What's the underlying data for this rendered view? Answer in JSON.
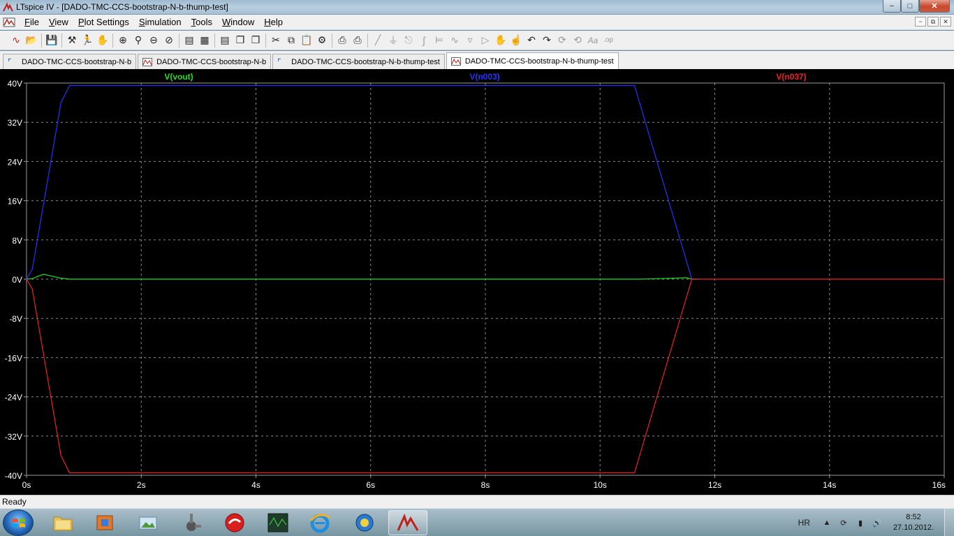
{
  "window": {
    "title": "LTspice IV - [DADO-TMC-CCS-bootstrap-N-b-thump-test]",
    "minimize": "−",
    "maximize": "□",
    "close": "✕"
  },
  "menu": {
    "items": [
      {
        "key": "F",
        "rest": "ile"
      },
      {
        "key": "V",
        "rest": "iew"
      },
      {
        "key": "P",
        "rest": "lot Settings"
      },
      {
        "key": "S",
        "rest": "imulation"
      },
      {
        "key": "T",
        "rest": "ools"
      },
      {
        "key": "W",
        "rest": "indow"
      },
      {
        "key": "H",
        "rest": "elp"
      }
    ],
    "mdi_minimize": "−",
    "mdi_restore": "⧉",
    "mdi_close": "✕"
  },
  "tabs": [
    {
      "label": "DADO-TMC-CCS-bootstrap-N-b",
      "kind": "schematic"
    },
    {
      "label": "DADO-TMC-CCS-bootstrap-N-b",
      "kind": "waveform"
    },
    {
      "label": "DADO-TMC-CCS-bootstrap-N-b-thump-test",
      "kind": "schematic"
    },
    {
      "label": "DADO-TMC-CCS-bootstrap-N-b-thump-test",
      "kind": "waveform",
      "active": true
    }
  ],
  "status": "Ready",
  "taskbar": {
    "language": "HR",
    "time": "8:52",
    "date": "27.10.2012."
  },
  "chart_data": {
    "type": "line",
    "title": "",
    "xlabel": "",
    "ylabel": "",
    "xlim": [
      0,
      16
    ],
    "ylim": [
      -40,
      40
    ],
    "x_ticks": [
      "0s",
      "2s",
      "4s",
      "6s",
      "8s",
      "10s",
      "12s",
      "14s",
      "16s"
    ],
    "y_ticks": [
      "40V",
      "32V",
      "24V",
      "16V",
      "8V",
      "0V",
      "-8V",
      "-16V",
      "-24V",
      "-32V",
      "-40V"
    ],
    "grid": true,
    "legend": "top",
    "series": [
      {
        "name": "V(vout)",
        "color": "#22dd22",
        "x": [
          0,
          0.1,
          0.2,
          0.3,
          0.45,
          0.6,
          0.75,
          1.0,
          10.7,
          11.0,
          11.3,
          11.5,
          11.6,
          11.7
        ],
        "y": [
          0,
          0.1,
          0.6,
          1.0,
          0.6,
          0.2,
          0,
          0,
          0,
          0.1,
          0.2,
          0.3,
          0,
          0
        ]
      },
      {
        "name": "V(n003)",
        "color": "#2233ff",
        "x": [
          0,
          0.1,
          0.6,
          0.75,
          1.0,
          10.6,
          11.6,
          11.75
        ],
        "y": [
          0,
          2,
          36,
          39.5,
          39.5,
          39.5,
          0,
          0
        ]
      },
      {
        "name": "V(n037)",
        "color": "#ee2020",
        "x": [
          0,
          0.1,
          0.6,
          0.75,
          1.0,
          10.6,
          11.6,
          11.75,
          16
        ],
        "y": [
          0,
          -2,
          -36,
          -39.5,
          -39.5,
          -39.5,
          0,
          0,
          0
        ]
      }
    ]
  }
}
